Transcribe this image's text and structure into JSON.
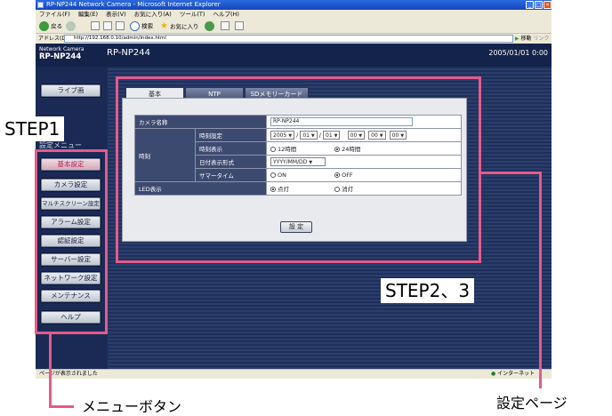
{
  "browser": {
    "title": "RP-NP244 Network Camera - Microsoft Internet Explorer",
    "menu": [
      "ファイル(F)",
      "編集(E)",
      "表示(V)",
      "お気に入り(A)",
      "ツール(T)",
      "ヘルプ(H)"
    ],
    "back": "戻る",
    "search": "検索",
    "favorites": "お気に入り",
    "address_label": "アドレス(D)",
    "address": "http://192.168.0.10/admin/index.html",
    "go": "移動",
    "links": "リンク",
    "status": "ページが表示されました",
    "zone": "インターネット"
  },
  "camera": {
    "logo_line1": "Network Camera",
    "logo_line2": "RP-NP244",
    "name": "RP-NP244",
    "datetime": "2005/01/01  0:00"
  },
  "sidebar": {
    "live_button": "ライブ画",
    "settings_menu_label": "設定メニュー",
    "items": [
      {
        "label": "基本設定"
      },
      {
        "label": "カメラ設定"
      },
      {
        "label": "マルチスクリーン設定"
      },
      {
        "label": "アラーム設定"
      },
      {
        "label": "認証設定"
      },
      {
        "label": "サーバー設定"
      },
      {
        "label": "ネットワーク設定"
      },
      {
        "label": "メンテナンス"
      },
      {
        "label": "ヘルプ"
      }
    ]
  },
  "tabs": [
    {
      "label": "基本"
    },
    {
      "label": "NTP"
    },
    {
      "label": "SDメモリーカード"
    }
  ],
  "form": {
    "camera_name_label": "カメラ名称",
    "camera_name_value": "RP-NP244",
    "time_label": "時刻",
    "time_setting_label": "時刻設定",
    "year": "2005",
    "month": "01",
    "day": "01",
    "hour": "00",
    "minute": "00",
    "second": "00",
    "time_display_label": "時刻表示",
    "time_12h": "12時間",
    "time_24h": "24時間",
    "date_format_label": "日付表示形式",
    "date_format_value": "YYYY/MM/DD",
    "summer_time_label": "サマータイム",
    "on": "ON",
    "off": "OFF",
    "led_label": "LED表示",
    "led_on": "点灯",
    "led_off": "消灯",
    "apply": "設 定"
  },
  "annotations": {
    "step1": "STEP1",
    "step23": "STEP2、3",
    "menu_buttons": "メニューボタン",
    "settings_page": "設定ページ"
  },
  "colors": {
    "annotation_pink": "#e55a8c",
    "header_navy": "#14234a",
    "active_menu_text": "#b22255"
  }
}
